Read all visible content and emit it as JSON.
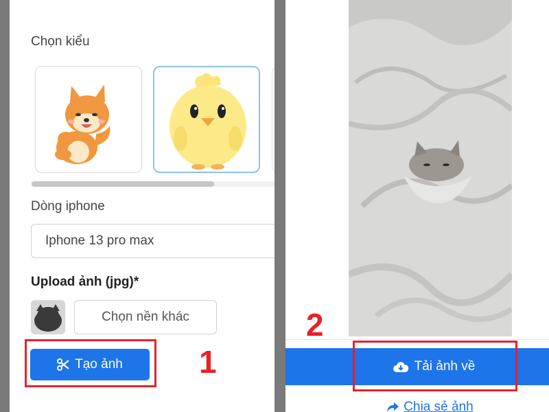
{
  "left": {
    "choose_style_label": "Chọn kiểu",
    "styles": [
      {
        "name": "shiba dog sticker",
        "selected": false
      },
      {
        "name": "yellow chick sticker",
        "selected": true
      }
    ],
    "phone_model_label": "Dòng iphone",
    "phone_model_value": "Iphone 13 pro max",
    "upload_label": "Upload ảnh (jpg)*",
    "choose_background_button": "Chọn nền khác",
    "create_button": "Tạo ảnh",
    "create_icon": "scissors-icon",
    "step_number": "1"
  },
  "right": {
    "download_button": "Tải ảnh về",
    "download_icon": "cloud-download-icon",
    "share_link": "Chia sẻ ảnh",
    "share_icon": "share-arrow-icon",
    "step_number": "2"
  },
  "colors": {
    "accent_blue": "#1e74e9",
    "highlight_red": "#e8222a",
    "selected_border": "#8fbff0"
  }
}
